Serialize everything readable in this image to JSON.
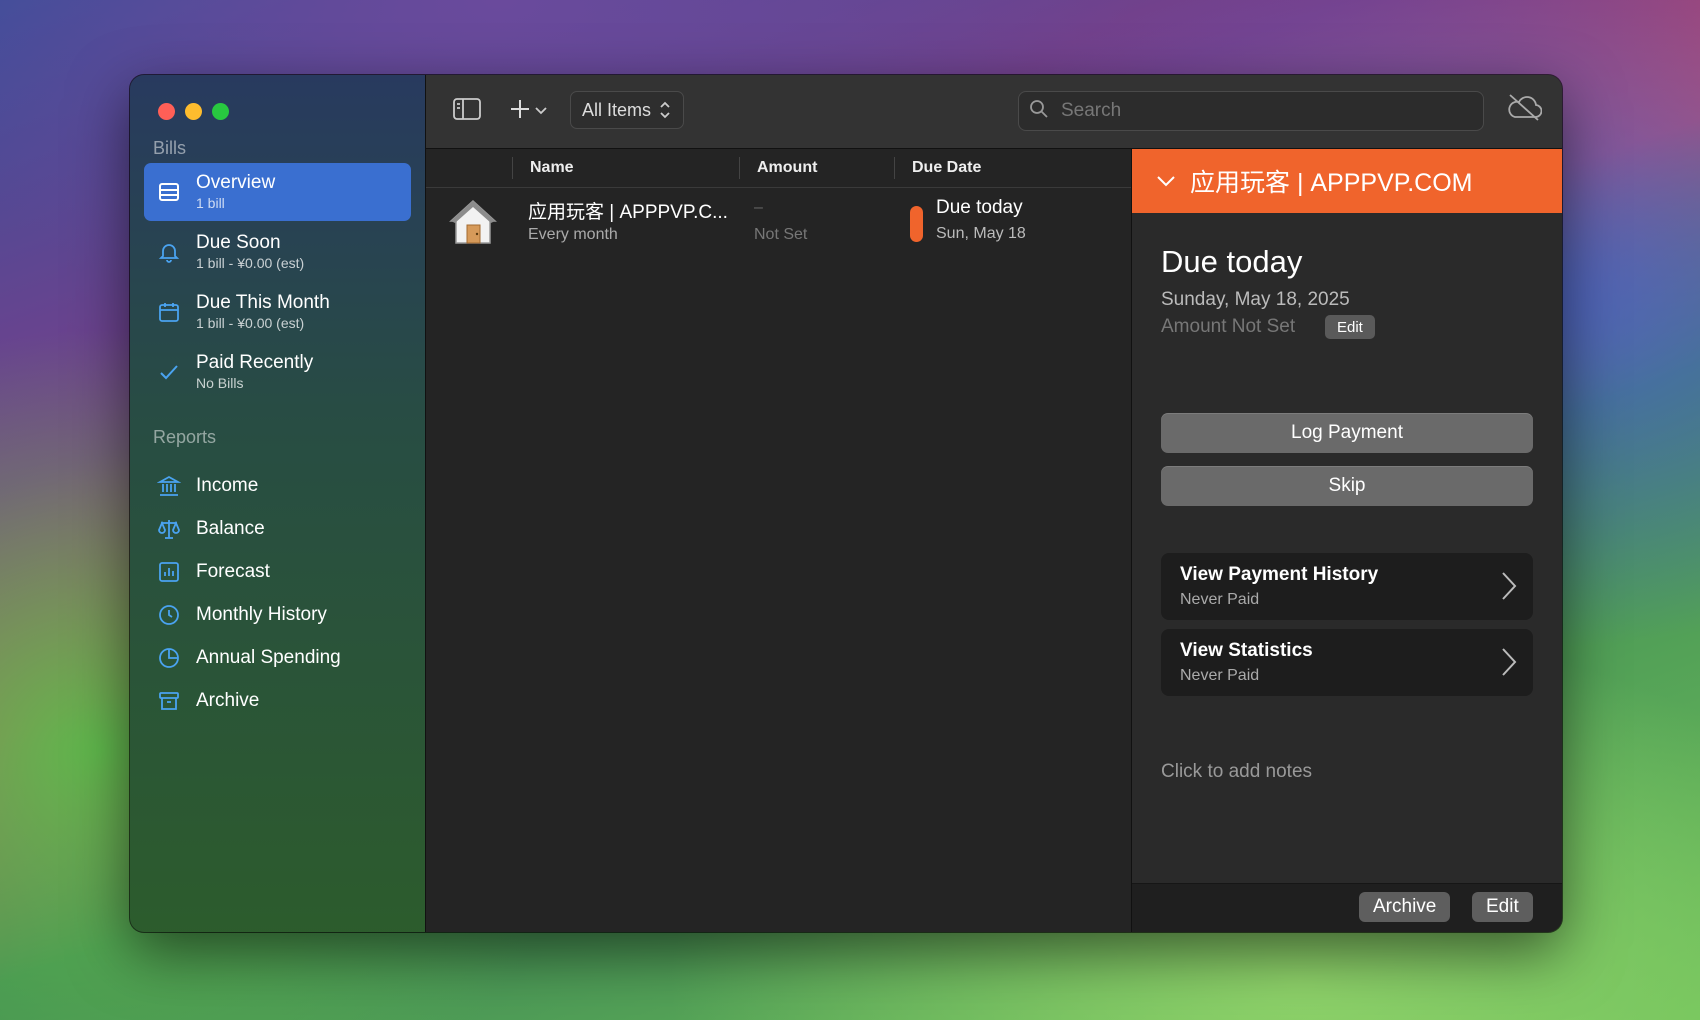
{
  "sidebar": {
    "bills_label": "Bills",
    "reports_label": "Reports",
    "bills": [
      {
        "title": "Overview",
        "subtitle": "1 bill",
        "icon": "list-icon"
      },
      {
        "title": "Due Soon",
        "subtitle": "1 bill - ¥0.00 (est)",
        "icon": "bell-icon"
      },
      {
        "title": "Due This Month",
        "subtitle": "1 bill - ¥0.00 (est)",
        "icon": "calendar-icon"
      },
      {
        "title": "Paid Recently",
        "subtitle": "No Bills",
        "icon": "checkmark-icon"
      }
    ],
    "reports": [
      {
        "title": "Income",
        "icon": "bank-icon"
      },
      {
        "title": "Balance",
        "icon": "scale-icon"
      },
      {
        "title": "Forecast",
        "icon": "chart-icon"
      },
      {
        "title": "Monthly History",
        "icon": "clock-icon"
      },
      {
        "title": "Annual Spending",
        "icon": "pie-icon"
      },
      {
        "title": "Archive",
        "icon": "archive-icon"
      }
    ]
  },
  "toolbar": {
    "filter_label": "All Items",
    "search_placeholder": "Search"
  },
  "list": {
    "columns": {
      "name": "Name",
      "amount": "Amount",
      "due_date": "Due Date"
    },
    "rows": [
      {
        "name": "应用玩客 | APPPVP.C...",
        "frequency": "Every month",
        "amount_dash": "–",
        "amount": "Not Set",
        "due_title": "Due today",
        "due_date": "Sun, May 18"
      }
    ]
  },
  "detail": {
    "header_title": "应用玩客 | APPPVP.COM",
    "header_color": "#f0642c",
    "due_title": "Due today",
    "due_date": "Sunday, May 18, 2025",
    "amount": "Amount Not Set",
    "edit_amount_label": "Edit",
    "log_payment_label": "Log Payment",
    "skip_label": "Skip",
    "cards": [
      {
        "title": "View Payment History",
        "subtitle": "Never Paid"
      },
      {
        "title": "View Statistics",
        "subtitle": "Never Paid"
      }
    ],
    "notes_placeholder": "Click to add notes",
    "archive_label": "Archive",
    "edit_label": "Edit"
  },
  "colors": {
    "accent_blue": "#3a6fd0",
    "icon_blue": "#4aa3f0",
    "due_orange": "#f0642c"
  }
}
